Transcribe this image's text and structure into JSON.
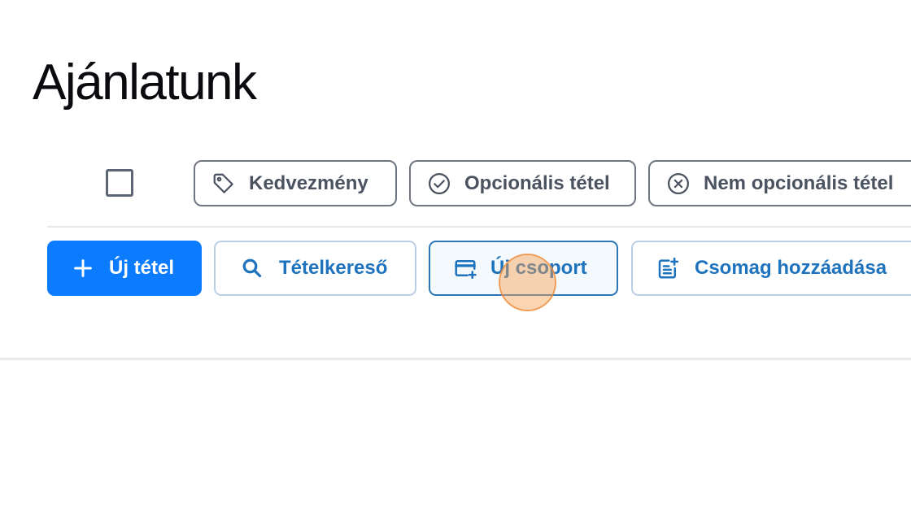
{
  "page": {
    "title": "Ajánlatunk"
  },
  "filters": {
    "select_all_checked": false,
    "chips": [
      {
        "label": "Kedvezmény",
        "icon": "tag-icon"
      },
      {
        "label": "Opcionális tétel",
        "icon": "check-circle-icon"
      },
      {
        "label": "Nem opcionális tétel",
        "icon": "x-circle-icon"
      }
    ]
  },
  "actions": {
    "new_item": {
      "label": "Új tétel",
      "icon": "plus-icon"
    },
    "item_search": {
      "label": "Tételkereső",
      "icon": "search-icon"
    },
    "new_group": {
      "label": "Új csoport",
      "icon": "card-plus-icon"
    },
    "add_package": {
      "label": "Csomag hozzáadása",
      "icon": "note-add-icon"
    }
  },
  "colors": {
    "primary": "#0b7cff",
    "link_blue": "#1e73be",
    "chip_text": "#4b5260",
    "cursor_highlight": "#f7a050"
  }
}
